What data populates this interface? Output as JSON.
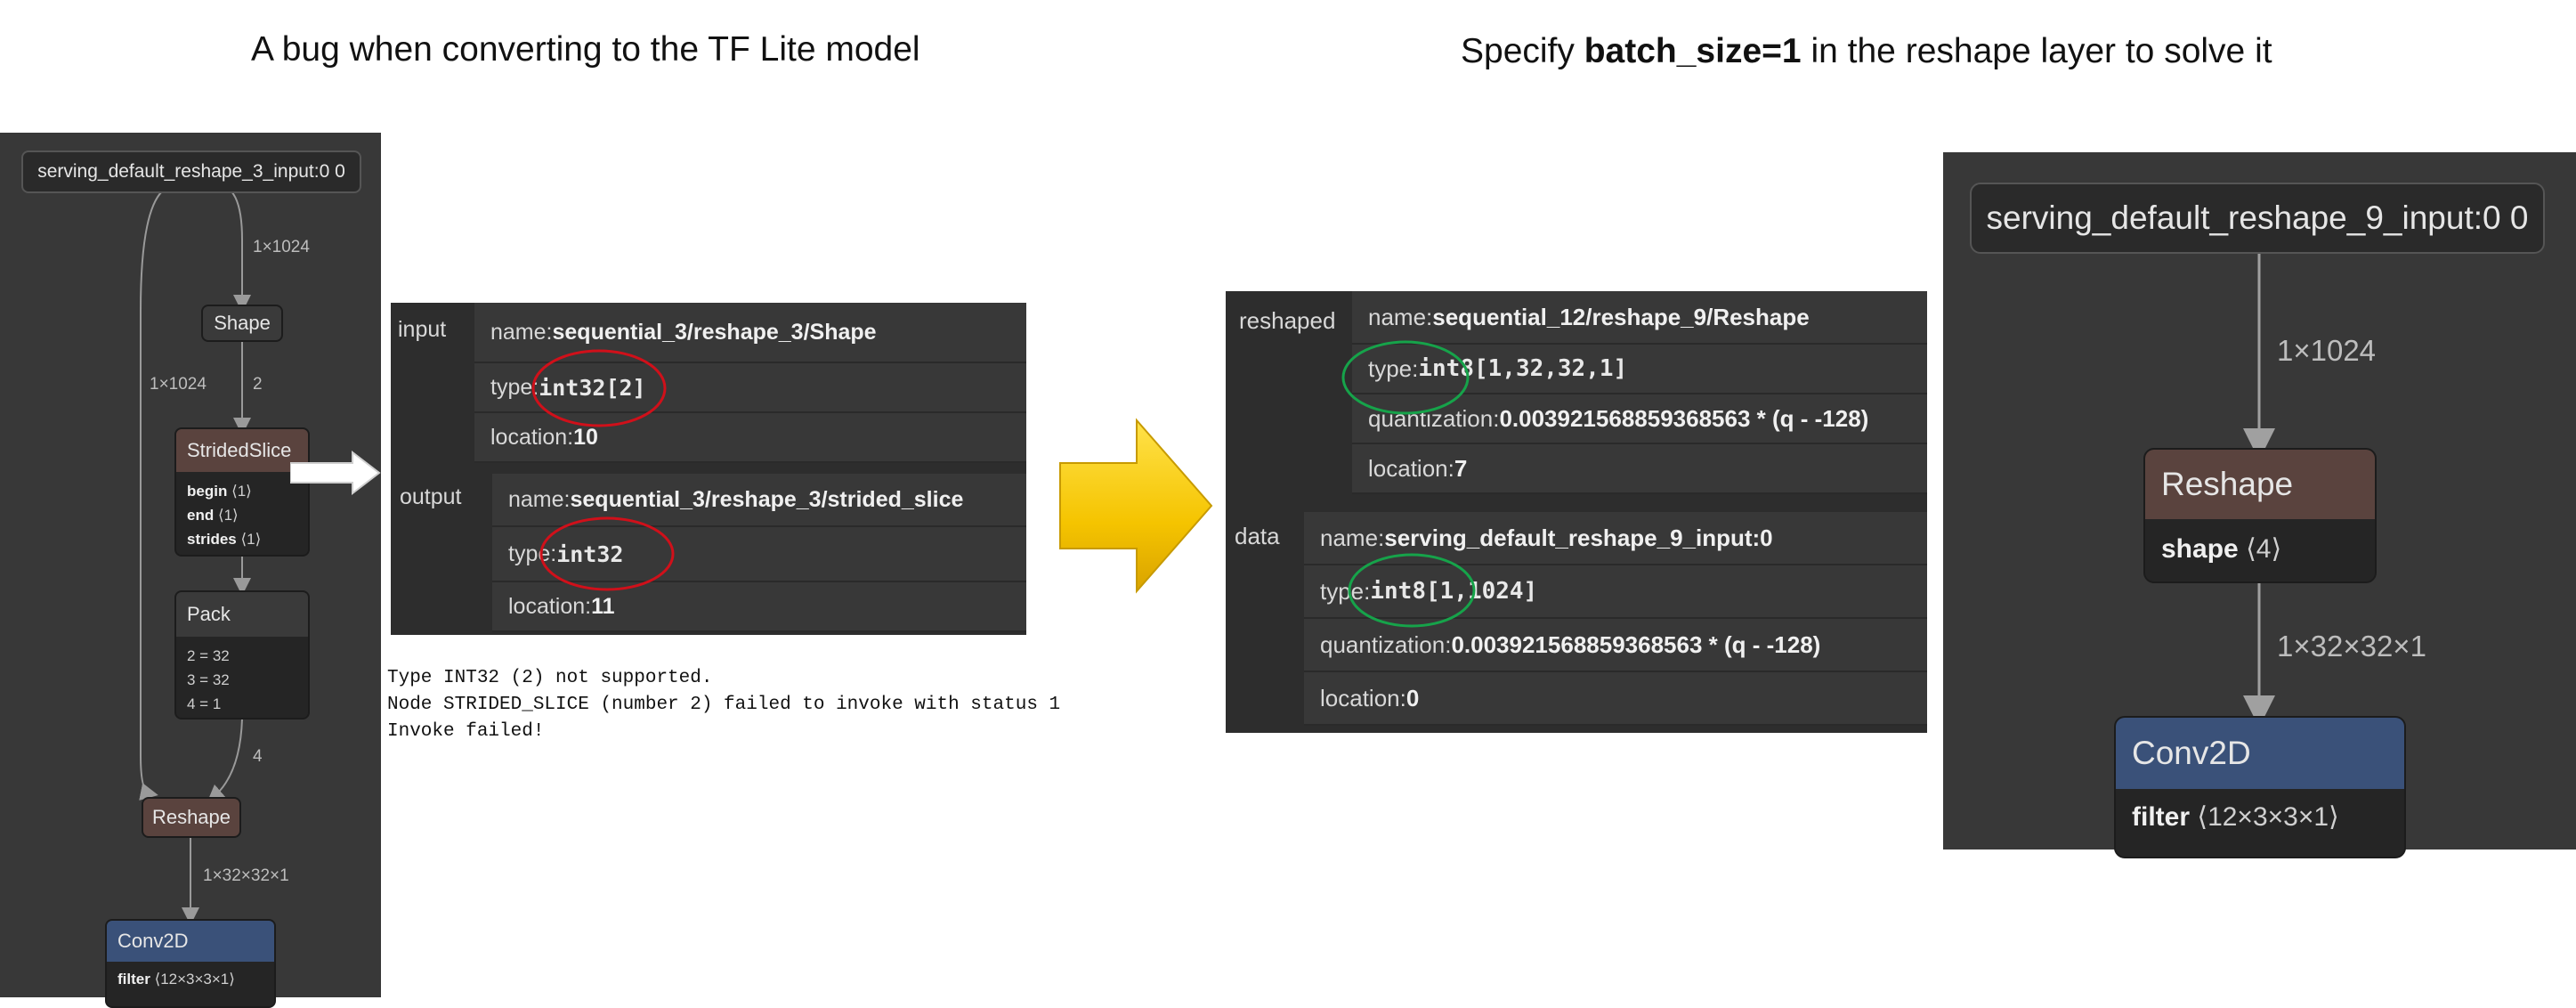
{
  "titles": {
    "left": "A bug when converting to the TF Lite model",
    "right_prefix": "Specify ",
    "right_bold": "batch_size=1",
    "right_suffix": " in the reshape layer to solve it"
  },
  "left_graph": {
    "input_node": "serving_default_reshape_3_input:0 0",
    "edge_1x1024_a": "1×1024",
    "edge_1x1024_b": "1×1024",
    "edge_2": "2",
    "edge_4": "4",
    "edge_out": "1×32×32×1",
    "shape_node": "Shape",
    "strided_slice": {
      "title": "StridedSlice",
      "attrs": [
        {
          "key": "begin",
          "value": "⟨1⟩"
        },
        {
          "key": "end",
          "value": "⟨1⟩"
        },
        {
          "key": "strides",
          "value": "⟨1⟩"
        }
      ]
    },
    "pack": {
      "title": "Pack",
      "lines": [
        "2 = 32",
        "3 = 32",
        "4 = 1"
      ]
    },
    "reshape_node": "Reshape",
    "conv2d": {
      "title": "Conv2D",
      "attr_key": "filter",
      "attr_value": "⟨12×3×3×1⟩"
    }
  },
  "left_panel": {
    "input_label": "input",
    "input_name_key": "name: ",
    "input_name": "sequential_3/reshape_3/Shape",
    "input_type_key": "type: ",
    "input_type": "int32[2]",
    "input_loc_key": "location: ",
    "input_loc": "10",
    "output_label": "output",
    "output_name_key": "name: ",
    "output_name": "sequential_3/reshape_3/strided_slice",
    "output_type_key": "type: ",
    "output_type": "int32",
    "output_loc_key": "location: ",
    "output_loc": "11"
  },
  "error_lines": [
    "Type INT32 (2) not supported.",
    "Node STRIDED_SLICE (number 2) failed to invoke with status 1",
    "Invoke failed!"
  ],
  "right_panel": {
    "reshaped_label": "reshaped",
    "r_name_key": "name: ",
    "r_name": "sequential_12/reshape_9/Reshape",
    "r_type_key": "type: ",
    "r_type": "int8[1,32,32,1]",
    "r_quant_key": "quantization: ",
    "r_quant": "0.003921568859368563 * (q - -128)",
    "r_loc_key": "location: ",
    "r_loc": "7",
    "data_label": "data",
    "d_name_key": "name: ",
    "d_name": "serving_default_reshape_9_input:0",
    "d_type_key": "type: ",
    "d_type": "int8[1,1024]",
    "d_quant_key": "quantization: ",
    "d_quant": "0.003921568859368563 * (q - -128)",
    "d_loc_key": "location: ",
    "d_loc": "0"
  },
  "right_graph": {
    "input_node": "serving_default_reshape_9_input:0 0",
    "edge_in": "1×1024",
    "reshape": {
      "title": "Reshape",
      "attr_key": "shape",
      "attr_value": "⟨4⟩"
    },
    "edge_out": "1×32×32×1",
    "conv2d": {
      "title": "Conv2D",
      "attr_key": "filter",
      "attr_value": "⟨12×3×3×1⟩"
    }
  },
  "colors": {
    "graph_bg": "#383838",
    "reshape_head": "#5a433e",
    "conv_head": "#3a5179",
    "node_head": "#3a3a3a",
    "error_circle": "#d0101a",
    "fix_circle": "#16a34a",
    "arrow_yellow": "#f5c400"
  }
}
